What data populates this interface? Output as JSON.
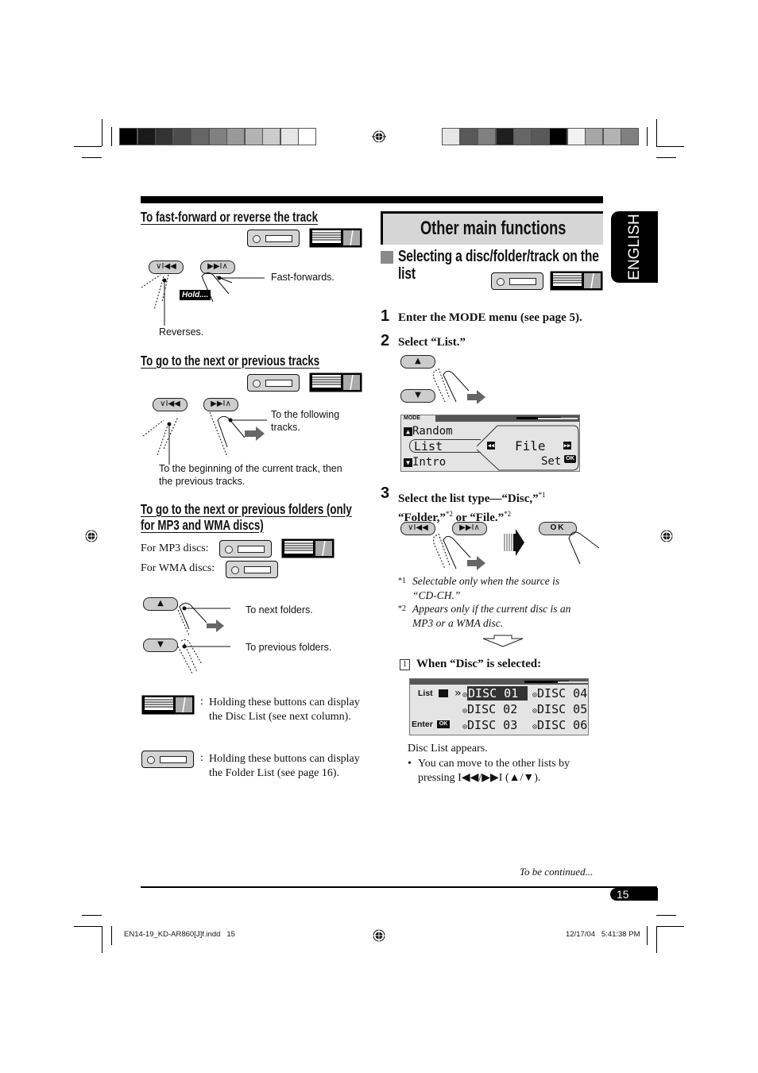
{
  "print_marks": {
    "color_bar_left": [
      "#000000",
      "#1a1a1a",
      "#333333",
      "#4d4d4d",
      "#666666",
      "#808080",
      "#999999",
      "#b3b3b3",
      "#cccccc",
      "#e6e6e6",
      "#ffffff"
    ],
    "color_bar_right": [
      "#e6e6e6",
      "#595959",
      "#808080",
      "#1f1f1f",
      "#666666",
      "#595959",
      "#000000",
      "#f2f2f2",
      "#a6a6a6",
      "#b3b3b3",
      "#808080"
    ]
  },
  "left_column": {
    "sections": [
      {
        "title": "To fast-forward or reverse the track",
        "hold_label": "Hold....",
        "callout_right": "Fast-forwards.",
        "callout_bottom": "Reverses.",
        "btn_left": "∨I◀◀",
        "btn_right": "▶▶I∧"
      },
      {
        "title": "To go to the next or previous tracks",
        "callout_right": "To the following tracks.",
        "callout_bottom": "To the beginning of the current track, then the previous tracks.",
        "btn_left": "∨I◀◀",
        "btn_right": "▶▶I∧"
      },
      {
        "title_line1": "To go to the next or previous folders (only",
        "title_line2": "for MP3 and WMA discs)",
        "mp3_label": "For MP3 discs:",
        "wma_label": "For WMA discs:",
        "up_callout": "To next folders.",
        "down_callout": "To previous folders."
      }
    ],
    "legend": [
      {
        "icon": "cd-changer-icon",
        "sep": ":",
        "text": "Holding these buttons can display the Disc List (see next column)."
      },
      {
        "icon": "cd-player-icon",
        "sep": ":",
        "text": "Holding these buttons can display the Folder List (see page 16)."
      }
    ]
  },
  "right_column": {
    "chapter_title": "Other main functions",
    "section_title_line1": "Selecting a disc/folder/track on the",
    "section_title_line2": "list",
    "steps": [
      {
        "num": "1",
        "text": "Enter the MODE menu (see page 5)."
      },
      {
        "num": "2",
        "text": "Select “List.”"
      },
      {
        "num": "3",
        "text_line1": "Select the list type—“Disc,”",
        "sup1": "*1",
        "text_line2a": "“Folder,”",
        "sup2": "*2",
        "text_line2b": " or “File.”",
        "sup3": "*2"
      }
    ],
    "mode_display": {
      "tab": "MODE",
      "items": [
        "Random",
        "List",
        "Intro"
      ],
      "value": "File",
      "set_label": "Set",
      "ok_label": "OK"
    },
    "ok_button": "OK",
    "footnotes": [
      {
        "mark": "*1",
        "text_line1": "Selectable only when the source is",
        "text_line2": "“CD-CH.”"
      },
      {
        "mark": "*2",
        "text_line1": "Appears only if the current disc is an",
        "text_line2": "MP3 or a WMA disc."
      }
    ],
    "substep": {
      "num": "1",
      "text": "When “Disc” is selected:"
    },
    "disc_display": {
      "list_label": "List",
      "enter_label": "Enter",
      "ok_label": "OK",
      "discs": [
        "DISC 01",
        "DISC 02",
        "DISC 03",
        "DISC 04",
        "DISC 05",
        "DISC 06"
      ],
      "selected": "DISC 01"
    },
    "disc_list_appears": "Disc List appears.",
    "bullet_line1": "You can move to the other lists by",
    "bullet_line2": "pressing I◀◀/▶▶I (▲/▼)."
  },
  "side_tab": "ENGLISH",
  "footer": {
    "continued": "To be continued...",
    "page_number": "15",
    "file_name": "EN14-19_KD-AR860[J]f.indd   15",
    "timestamp": "12/17/04   5:41:38 PM"
  }
}
